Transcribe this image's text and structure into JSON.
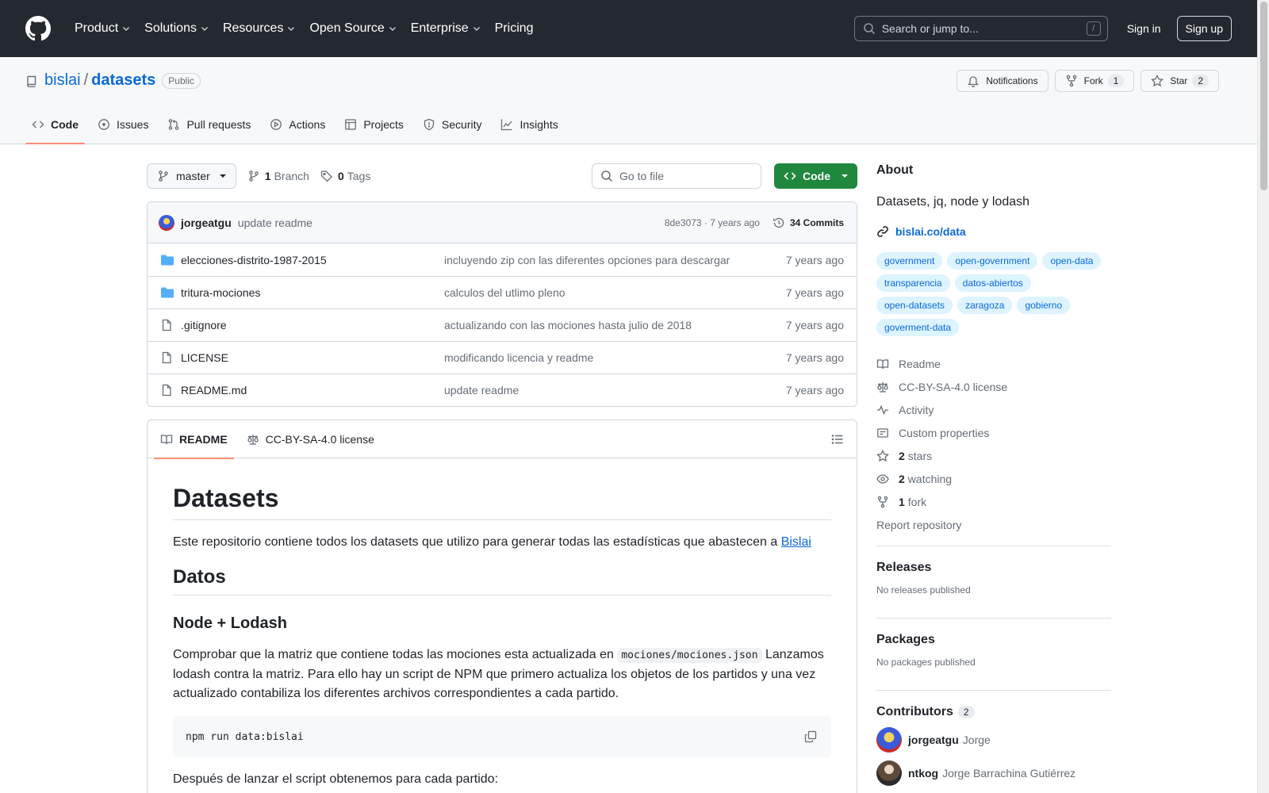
{
  "header": {
    "nav": [
      {
        "label": "Product",
        "has_menu": true
      },
      {
        "label": "Solutions",
        "has_menu": true
      },
      {
        "label": "Resources",
        "has_menu": true
      },
      {
        "label": "Open Source",
        "has_menu": true
      },
      {
        "label": "Enterprise",
        "has_menu": true
      },
      {
        "label": "Pricing",
        "has_menu": false
      }
    ],
    "search_placeholder": "Search or jump to...",
    "search_shortcut": "/",
    "sign_in": "Sign in",
    "sign_up": "Sign up"
  },
  "repo": {
    "owner": "bislai",
    "separator": "/",
    "name": "datasets",
    "visibility": "Public",
    "notifications_label": "Notifications",
    "fork_label": "Fork",
    "fork_count": "1",
    "star_label": "Star",
    "star_count": "2",
    "tabs": [
      {
        "label": "Code",
        "icon": "code-icon",
        "active": true
      },
      {
        "label": "Issues",
        "icon": "issue-icon",
        "active": false
      },
      {
        "label": "Pull requests",
        "icon": "pull-request-icon",
        "active": false
      },
      {
        "label": "Actions",
        "icon": "play-icon",
        "active": false
      },
      {
        "label": "Projects",
        "icon": "table-icon",
        "active": false
      },
      {
        "label": "Security",
        "icon": "shield-icon",
        "active": false
      },
      {
        "label": "Insights",
        "icon": "graph-icon",
        "active": false
      }
    ]
  },
  "file_nav": {
    "branch": "master",
    "branch_count": "1",
    "branch_word": "Branch",
    "tag_count": "0",
    "tag_word": "Tags",
    "goto_placeholder": "Go to file",
    "code_button": "Code"
  },
  "latest_commit": {
    "author": "jorgeatgu",
    "message": "update readme",
    "meta": "8de3073 · 7 years ago",
    "commits_label": "34 Commits"
  },
  "files": [
    {
      "name": "elecciones-distrito-1987-2015",
      "type": "folder",
      "commit": "incluyendo zip con las diferentes opciones para descargar",
      "age": "7 years ago"
    },
    {
      "name": "tritura-mociones",
      "type": "folder",
      "commit": "calculos del utlimo pleno",
      "age": "7 years ago"
    },
    {
      "name": ".gitignore",
      "type": "file",
      "commit": "actualizando con las mociones hasta julio de 2018",
      "age": "7 years ago"
    },
    {
      "name": "LICENSE",
      "type": "file",
      "commit": "modificando licencia y readme",
      "age": "7 years ago"
    },
    {
      "name": "README.md",
      "type": "file",
      "commit": "update readme",
      "age": "7 years ago"
    }
  ],
  "readme": {
    "tab_readme": "README",
    "tab_license": "CC-BY-SA-4.0 license",
    "h1": "Datasets",
    "intro": "Este repositorio contiene todos los datasets que utilizo para generar todas las estadísticas que abastecen a ",
    "intro_link": "Bislai",
    "h2": "Datos",
    "h3": "Node + Lodash",
    "p1_before": "Comprobar que la matriz que contiene todas las mociones esta actualizada en ",
    "p1_code": "mociones/mociones.json",
    "p1_after": " Lanzamos lodash contra la matriz. Para ello hay un script de NPM que primero actualiza los objetos de los partidos y una vez actualizado contabiliza los diferentes archivos correspondientes a cada partido.",
    "code": "npm run data:bislai",
    "p2": "Después de lanzar el script obtenemos para cada partido:"
  },
  "about": {
    "title": "About",
    "description": "Datasets, jq, node y lodash",
    "homepage": "bislai.co/data",
    "topics": [
      "government",
      "open-government",
      "open-data",
      "transparencia",
      "datos-abiertos",
      "open-datasets",
      "zaragoza",
      "gobierno",
      "goverment-data"
    ],
    "links": [
      {
        "icon": "book-icon",
        "count": "",
        "label": "Readme"
      },
      {
        "icon": "law-icon",
        "count": "",
        "label": "CC-BY-SA-4.0 license"
      },
      {
        "icon": "pulse-icon",
        "count": "",
        "label": "Activity"
      },
      {
        "icon": "note-icon",
        "count": "",
        "label": "Custom properties"
      },
      {
        "icon": "star-icon",
        "count": "2",
        "label": "stars"
      },
      {
        "icon": "eye-icon",
        "count": "2",
        "label": "watching"
      },
      {
        "icon": "fork-icon",
        "count": "1",
        "label": "fork"
      }
    ],
    "report": "Report repository"
  },
  "releases": {
    "title": "Releases",
    "empty": "No releases published"
  },
  "packages": {
    "title": "Packages",
    "empty": "No packages published"
  },
  "contributors": {
    "title": "Contributors",
    "count": "2",
    "people": [
      {
        "login": "jorgeatgu",
        "name": "Jorge"
      },
      {
        "login": "ntkog",
        "name": "Jorge Barrachina Gutiérrez"
      }
    ]
  },
  "colors": {
    "header_bg": "#24292f",
    "link": "#0969da",
    "primary_button": "#1f883d",
    "active_tab_underline": "#fd8c73",
    "topic_bg": "#ddf4ff"
  }
}
